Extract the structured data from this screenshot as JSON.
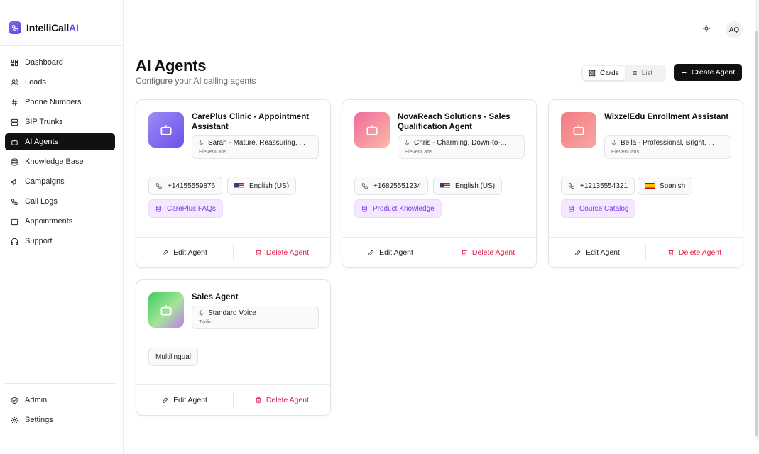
{
  "app": {
    "name_main": "IntelliCall",
    "name_accent": "AI"
  },
  "sidebar": {
    "items": [
      {
        "label": "Dashboard",
        "icon": "grid-icon"
      },
      {
        "label": "Leads",
        "icon": "users-icon"
      },
      {
        "label": "Phone Numbers",
        "icon": "hash-icon"
      },
      {
        "label": "SIP Trunks",
        "icon": "server-icon"
      },
      {
        "label": "AI Agents",
        "icon": "bot-icon",
        "active": true
      },
      {
        "label": "Knowledge Base",
        "icon": "database-icon"
      },
      {
        "label": "Campaigns",
        "icon": "megaphone-icon"
      },
      {
        "label": "Call Logs",
        "icon": "phone-icon"
      },
      {
        "label": "Appointments",
        "icon": "calendar-icon"
      },
      {
        "label": "Support",
        "icon": "headphones-icon"
      }
    ],
    "bottom": [
      {
        "label": "Admin",
        "icon": "shield-icon"
      },
      {
        "label": "Settings",
        "icon": "gear-icon"
      }
    ]
  },
  "topbar": {
    "avatar": "AQ",
    "theme_icon": "sun-icon"
  },
  "header": {
    "title": "AI Agents",
    "subtitle": "Configure your AI calling agents",
    "view_cards": "Cards",
    "view_list": "List",
    "create_label": "Create Agent"
  },
  "agents": [
    {
      "title": "CarePlus Clinic - Appointment Assistant",
      "voice": "Sarah - Mature, Reassuring, ...",
      "provider": "ElevenLabs",
      "phone": "+14155559876",
      "language": "English (US)",
      "knowledge": "CarePlus FAQs",
      "edit": "Edit Agent",
      "delete": "Delete Agent"
    },
    {
      "title": "NovaReach Solutions - Sales Qualification Agent",
      "voice": "Chris - Charming, Down-to-...",
      "provider": "ElevenLabs",
      "phone": "+16825551234",
      "language": "English (US)",
      "knowledge": "Product Knowledge",
      "edit": "Edit Agent",
      "delete": "Delete Agent"
    },
    {
      "title": "WixzelEdu Enrollment Assistant",
      "voice": "Bella - Professional, Bright, ...",
      "provider": "ElevenLabs",
      "phone": "+12135554321",
      "language": "Spanish",
      "knowledge": "Course Catalog",
      "edit": "Edit Agent",
      "delete": "Delete Agent"
    },
    {
      "title": "Sales Agent",
      "voice": "Standard Voice",
      "provider": "Twilio",
      "language": "Multilingual",
      "edit": "Edit Agent",
      "delete": "Delete Agent"
    }
  ],
  "colors": {
    "accent": "#6b4fe8",
    "delete": "#e11d48",
    "kb_chip": "#f3e8fe"
  }
}
